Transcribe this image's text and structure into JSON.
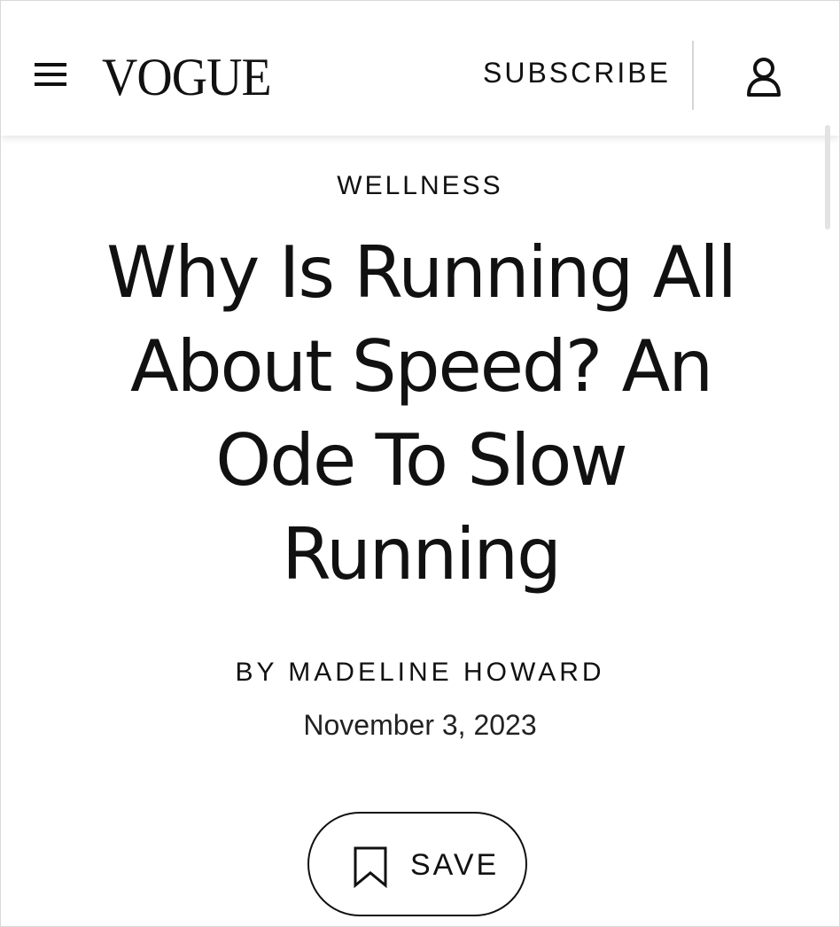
{
  "header": {
    "logo": "VOGUE",
    "subscribe_label": "SUBSCRIBE",
    "menu_icon": "hamburger-menu-icon",
    "account_icon": "user-account-icon"
  },
  "article": {
    "category": "WELLNESS",
    "headline_lines": [
      "Why Is Running All",
      "About Speed? An",
      "Ode To Slow",
      "Running"
    ],
    "byline_prefix": "BY",
    "author": "MADELINE HOWARD",
    "date": "November 3, 2023"
  },
  "actions": {
    "save_label": "SAVE",
    "save_icon": "bookmark-icon"
  },
  "colors": {
    "text": "#111111",
    "background": "#ffffff",
    "divider": "#d6d6d6"
  }
}
